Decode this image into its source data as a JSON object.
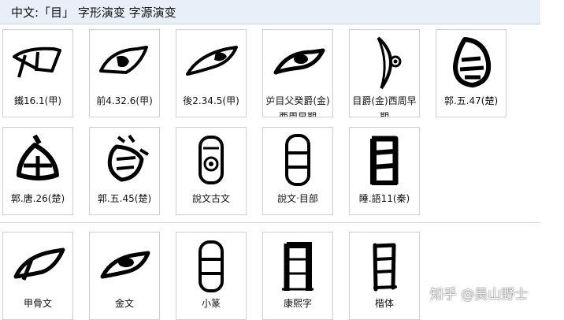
{
  "header": {
    "title": "中文:「目」 字形演变 字源演变"
  },
  "row1": [
    {
      "label": "鐵16.1(甲)",
      "glyph": "oracle-eye-glyph-1"
    },
    {
      "label": "前4.32.6(甲)",
      "glyph": "oracle-eye-glyph-2"
    },
    {
      "label": "後2.34.5(甲)",
      "glyph": "oracle-eye-glyph-3"
    },
    {
      "label": "屰目父癸爵(金)西周早期",
      "glyph": "bronze-eye-glyph-1"
    },
    {
      "label": "目爵(金)西周早期",
      "glyph": "bronze-eye-glyph-2"
    },
    {
      "label": "郭.五.47(楚)",
      "glyph": "chu-eye-glyph-1"
    }
  ],
  "row2": [
    {
      "label": "郭.唐.26(楚)",
      "glyph": "chu-eye-glyph-2"
    },
    {
      "label": "郭.五.45(楚)",
      "glyph": "chu-eye-glyph-3"
    },
    {
      "label": "說文古文",
      "glyph": "shuowen-guwen-glyph"
    },
    {
      "label": "說文‧目部",
      "glyph": "shuowen-mubu-glyph"
    },
    {
      "label": "睡.語11(秦)",
      "glyph": "qin-eye-glyph"
    }
  ],
  "row3": [
    {
      "label": "甲骨文",
      "glyph": "oracle-summary-glyph"
    },
    {
      "label": "金文",
      "glyph": "bronze-summary-glyph"
    },
    {
      "label": "小篆",
      "glyph": "seal-summary-glyph"
    },
    {
      "label": "康熙字",
      "glyph": "kangxi-glyph"
    },
    {
      "label": "楷体",
      "glyph": "kaiti-glyph"
    }
  ],
  "watermark": {
    "text": "知乎 @吴山野士"
  }
}
